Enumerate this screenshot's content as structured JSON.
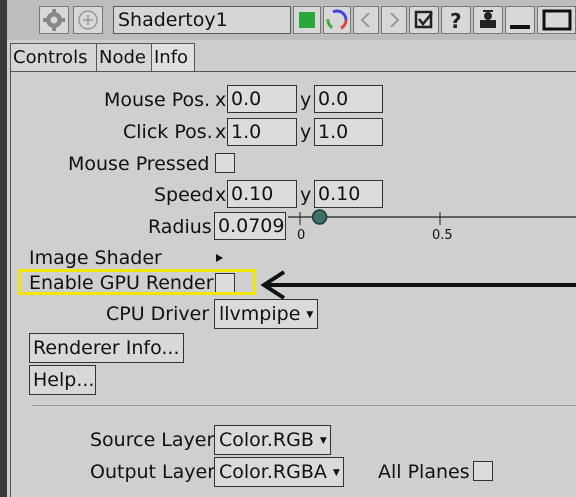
{
  "toolbar": {
    "title": "Shadertoy1",
    "icons": [
      "gear-icon",
      "add-icon",
      "color-swatch-icon",
      "color-wheel-icon",
      "arrow-left-icon",
      "arrow-right-icon",
      "checkbox-icon",
      "help-icon",
      "sticker-icon",
      "minimize-icon",
      "maximize-icon"
    ]
  },
  "tabs": [
    {
      "label": "Controls",
      "active": false
    },
    {
      "label": "Node",
      "active": false
    },
    {
      "label": "Info",
      "active": true
    }
  ],
  "controls": {
    "mouse_pos": {
      "label": "Mouse Pos.",
      "x_label": "x",
      "y_label": "y",
      "x": "0.0",
      "y": "0.0"
    },
    "click_pos": {
      "label": "Click Pos.",
      "x_label": "x",
      "y_label": "y",
      "x": "1.0",
      "y": "1.0"
    },
    "mouse_pressed": {
      "label": "Mouse Pressed",
      "checked": false
    },
    "speed": {
      "label": "Speed",
      "x_label": "x",
      "y_label": "y",
      "x": "0.10",
      "y": "0.10"
    },
    "radius": {
      "label": "Radius",
      "value": "0.0709",
      "slider_tick_0": "0",
      "slider_tick_1": "0.5",
      "slider_fraction": 0.07
    },
    "image_shader": {
      "label": "Image Shader"
    },
    "enable_gpu": {
      "label": "Enable GPU Render",
      "checked": false
    },
    "cpu_driver": {
      "label": "CPU Driver",
      "value": "llvmpipe"
    },
    "renderer_info_button": "Renderer Info...",
    "help_button": "Help...",
    "source_layer": {
      "label": "Source Layer",
      "value": "Color.RGB"
    },
    "output_layer": {
      "label": "Output Layer",
      "value": "Color.RGBA"
    },
    "all_planes": {
      "label": "All Planes",
      "checked": false
    }
  },
  "colors": {
    "highlight": "#f2e600",
    "arrow": "#111111",
    "swatch_green": "#27a83a"
  }
}
